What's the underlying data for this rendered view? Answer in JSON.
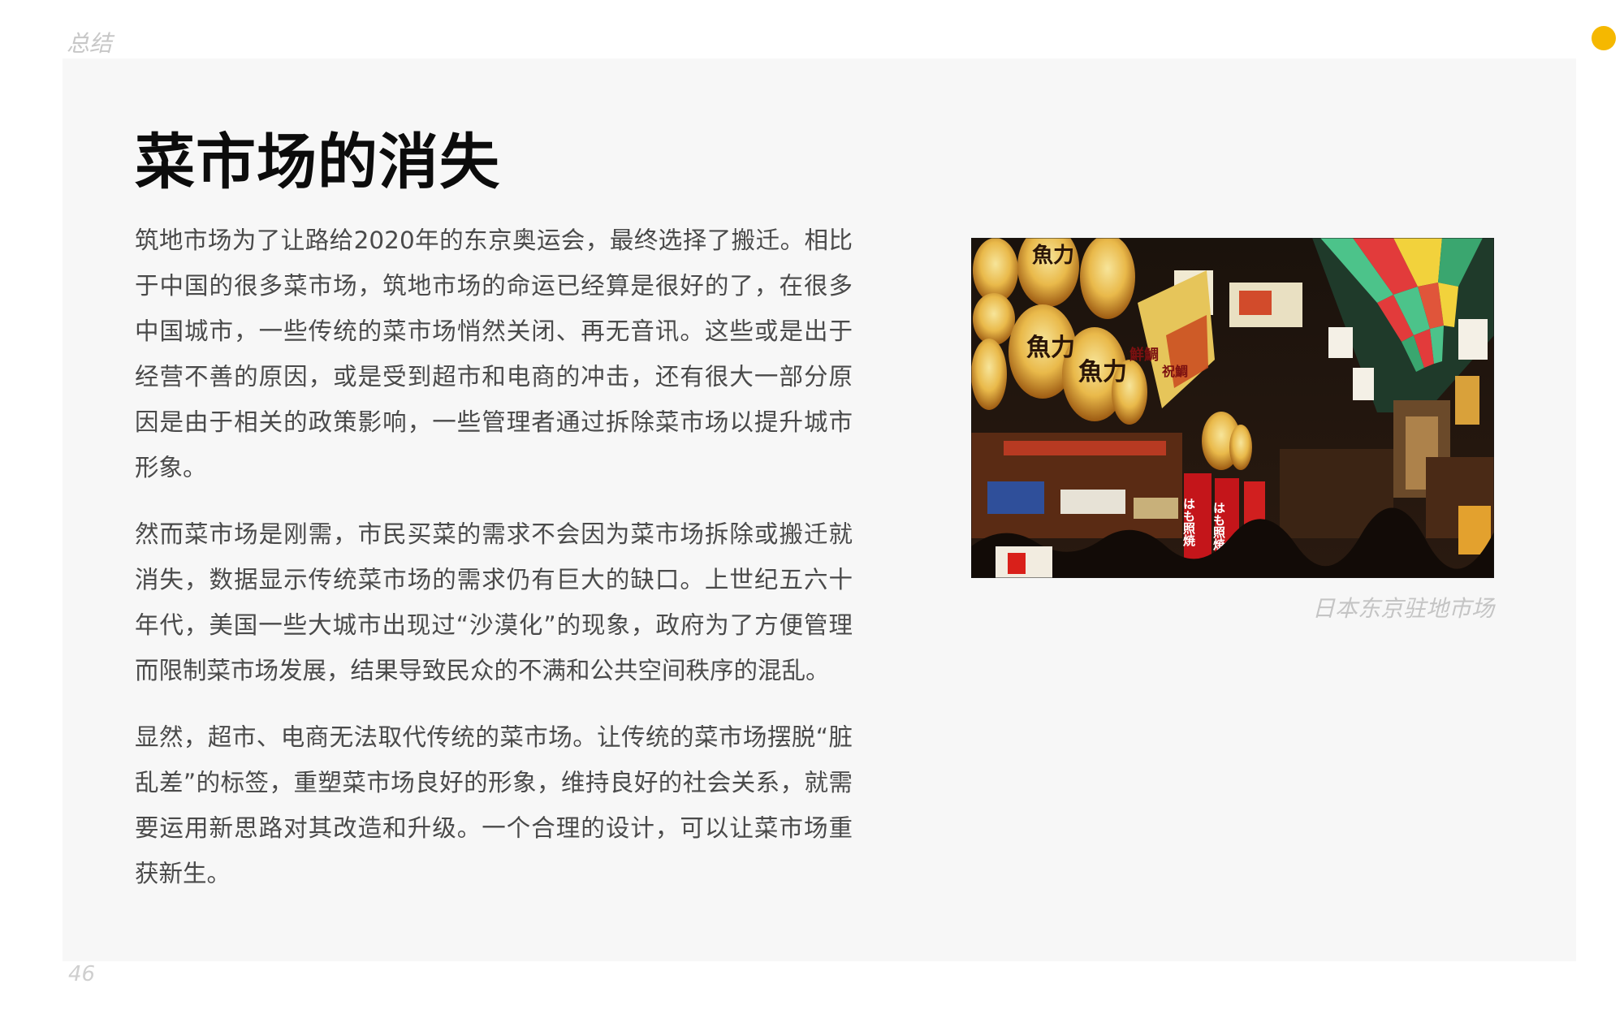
{
  "header": {
    "section_label": "总结"
  },
  "accent_color": "#f5b800",
  "article": {
    "title": "菜市场的消失",
    "paragraphs": [
      "筑地市场为了让路给2020年的东京奥运会，最终选择了搬迁。相比于中国的很多菜市场，筑地市场的命运已经算是很好的了，在很多中国城市，一些传统的菜市场悄然关闭、再无音讯。这些或是出于经营不善的原因，或是受到超市和电商的冲击，还有很大一部分原因是由于相关的政策影响，一些管理者通过拆除菜市场以提升城市形象。",
      "然而菜市场是刚需，市民买菜的需求不会因为菜市场拆除或搬迁就消失，数据显示传统菜市场的需求仍有巨大的缺口。上世纪五六十年代，美国一些大城市出现过“沙漠化”的现象，政府为了方便管理而限制菜市场发展，结果导致民众的不满和公共空间秩序的混乱。",
      "显然，超市、电商无法取代传统的菜市场。让传统的菜市场摆脱“脏乱差”的标签，重塑菜市场良好的形象，维持良好的社会关系，就需要运用新思路对其改造和升级。一个合理的设计，可以让菜市场重获新生。"
    ]
  },
  "photo": {
    "caption": "日本东京驻地市场",
    "lantern_texts": [
      "魚力",
      "魚力",
      "魚力",
      "はも照焼",
      "はも照焼",
      "鮮鯛",
      "祝鯛"
    ]
  },
  "footer": {
    "page_number": "46"
  }
}
